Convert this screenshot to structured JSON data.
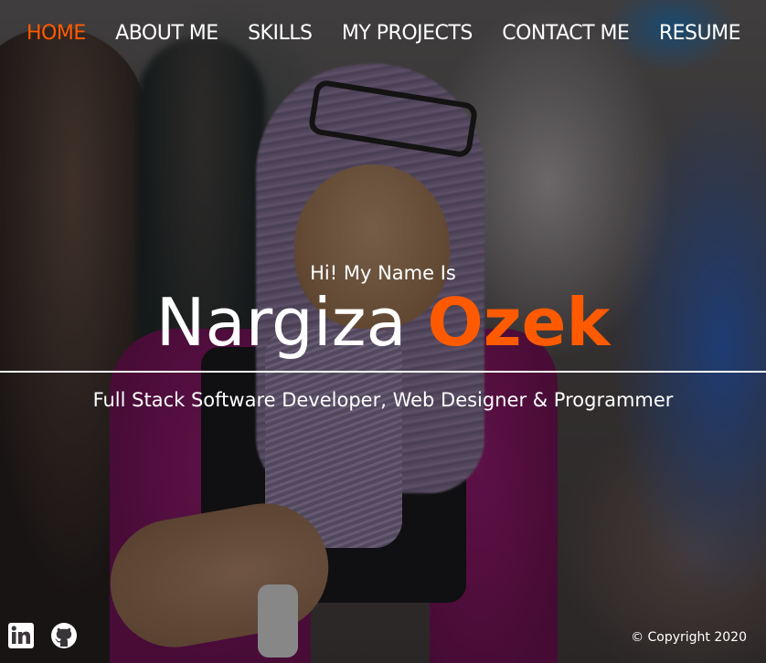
{
  "nav": {
    "items": [
      {
        "label": "HOME",
        "active": true
      },
      {
        "label": "ABOUT ME"
      },
      {
        "label": "SKILLS"
      },
      {
        "label": "MY PROJECTS"
      },
      {
        "label": "CONTACT ME"
      },
      {
        "label": "RESUME"
      }
    ]
  },
  "hero": {
    "greeting": "Hi! My Name Is",
    "first_name": "Nargiza",
    "last_name": "Ozek",
    "tagline": "Full Stack Software Developer, Web Designer & Programmer"
  },
  "footer": {
    "social": [
      {
        "icon": "linkedin-icon"
      },
      {
        "icon": "github-icon"
      }
    ],
    "copyright": "© Copyright 2020"
  },
  "colors": {
    "accent": "#ff5a00",
    "text": "#ffffff"
  }
}
